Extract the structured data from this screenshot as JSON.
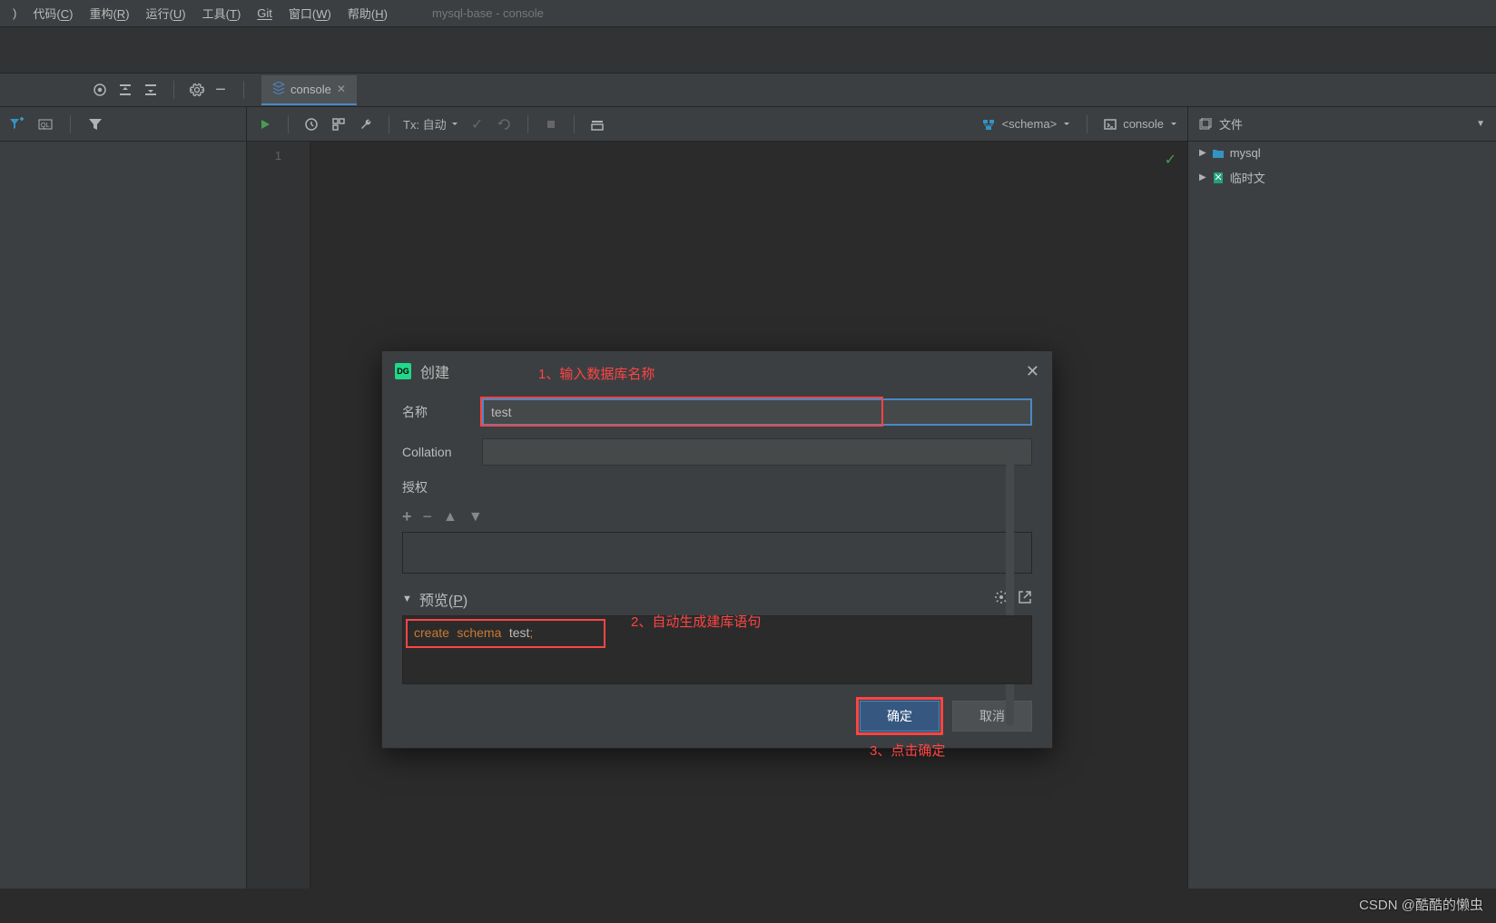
{
  "menubar": {
    "items": [
      {
        "label": ")"
      },
      {
        "label": "代码",
        "u": "C"
      },
      {
        "label": "重构",
        "u": "R"
      },
      {
        "label": "运行",
        "u": "U"
      },
      {
        "label": "工具",
        "u": "T"
      },
      {
        "label": "Git",
        "u": ""
      },
      {
        "label": "窗口",
        "u": "W"
      },
      {
        "label": "帮助",
        "u": "H"
      }
    ],
    "title": "mysql-base - console"
  },
  "tab": {
    "label": "console"
  },
  "editor_toolbar": {
    "tx_label": "Tx: 自动",
    "schema_label": "<schema>",
    "console_label": "console"
  },
  "gutter": {
    "line1": "1"
  },
  "right_panel": {
    "header": "文件",
    "item1": "mysql",
    "item2": "临时文"
  },
  "dialog": {
    "title": "创建",
    "name_label": "名称",
    "name_value": "test",
    "collation_label": "Collation",
    "collation_value": "",
    "grant_label": "授权",
    "preview_label": "预览",
    "preview_u": "P",
    "sql_kw1": "create",
    "sql_kw2": "schema",
    "sql_name": "test",
    "ok_label": "确定",
    "cancel_label": "取消"
  },
  "annotations": {
    "a1": "1、输入数据库名称",
    "a2": "2、自动生成建库语句",
    "a3": "3、点击确定"
  },
  "watermark": "CSDN @酷酷的懒虫"
}
